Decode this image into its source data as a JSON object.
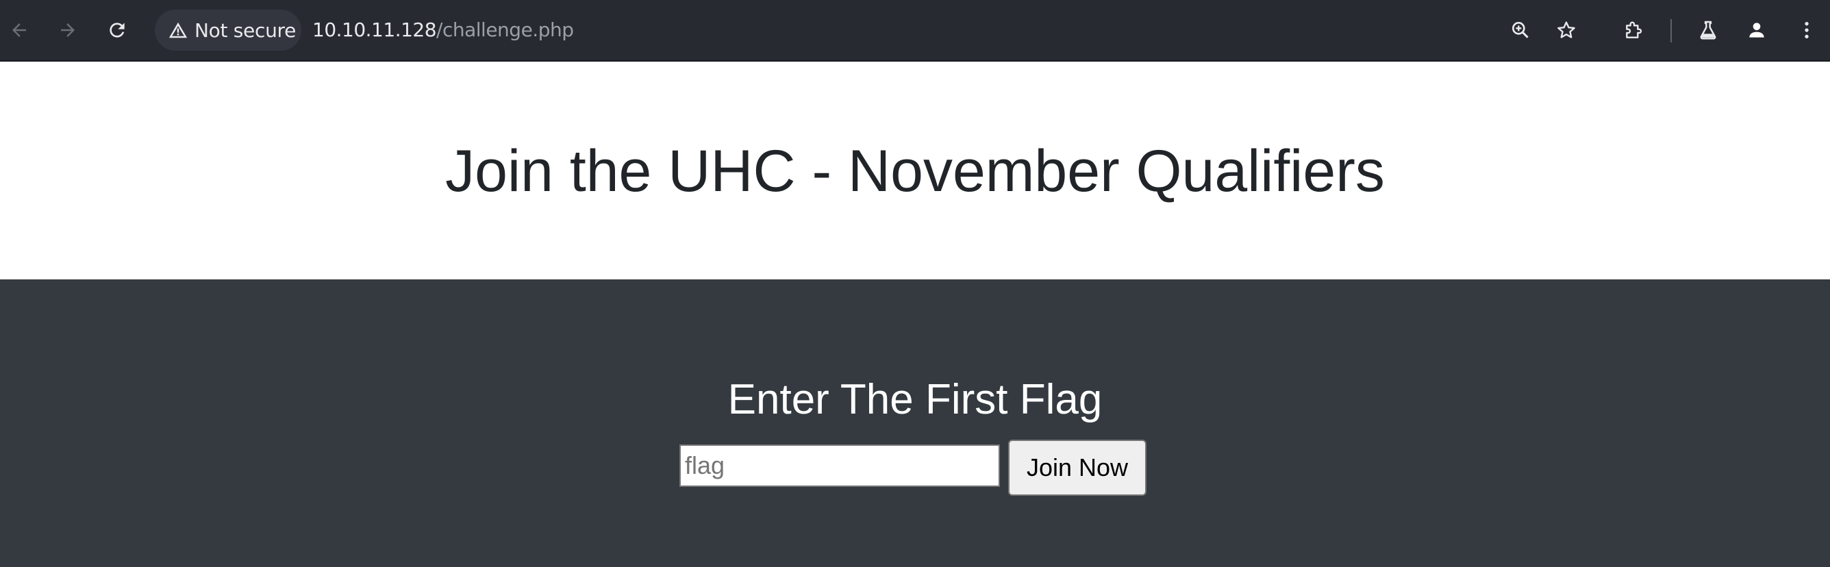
{
  "browser": {
    "security_label": "Not secure",
    "url_host": "10.10.11.128",
    "url_path": "/challenge.php",
    "icons": {
      "back": "arrow-left-icon",
      "forward": "arrow-right-icon",
      "reload": "reload-icon",
      "warning": "warning-triangle-icon",
      "zoom": "zoom-in-icon",
      "bookmark": "star-icon",
      "extensions": "puzzle-icon",
      "labs": "flask-icon",
      "profile": "person-icon",
      "menu": "three-dots-icon"
    },
    "colors": {
      "toolbar_bg": "#282a31",
      "chip_bg": "#33363e",
      "text": "#e8eaed",
      "muted": "#9aa0a6"
    }
  },
  "header": {
    "title": "Join the UHC - November Qualifiers"
  },
  "form": {
    "heading": "Enter The First Flag",
    "input_placeholder": "flag",
    "input_value": "",
    "submit_label": "Join Now"
  },
  "colors": {
    "header_bg": "#ffffff",
    "section_bg": "#343a40",
    "title_text": "#212529"
  }
}
